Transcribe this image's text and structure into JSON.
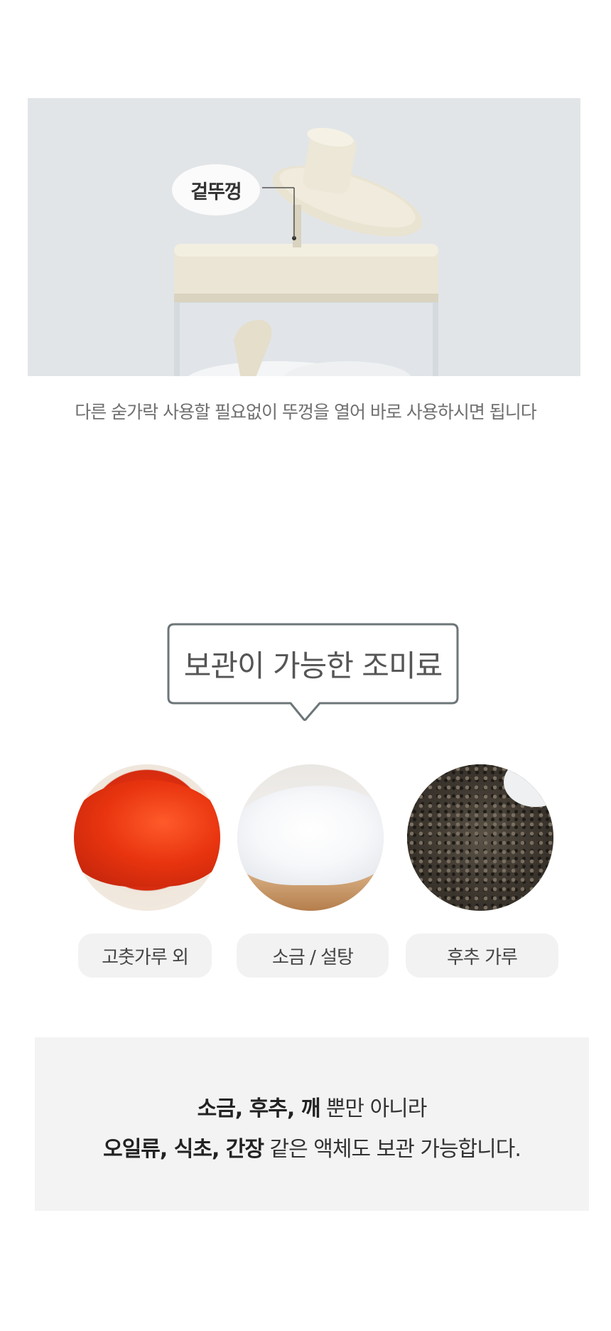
{
  "photo": {
    "label": "겉뚜껑",
    "caption": "다른 숟가락 사용할 필요없이 뚜껑을 열어 바로 사용하시면 됩니다"
  },
  "storage": {
    "title": "보관이 가능한 조미료",
    "items": [
      {
        "label": "고춧가루 외"
      },
      {
        "label": "소금 / 설탕"
      },
      {
        "label": "후추 가루"
      }
    ]
  },
  "panel": {
    "line1_bold": "소금, 후추, 깨",
    "line1_rest": " 뿐만 아니라",
    "line2_bold": "오일류, 식초, 간장",
    "line2_rest": " 같은 액체도 보관 가능합니다."
  },
  "colors": {
    "cap": "#e9e4d3",
    "panel_bg": "#f3f3f3",
    "pill_bg": "#f2f2f2",
    "bubble_border": "#6c7678"
  }
}
